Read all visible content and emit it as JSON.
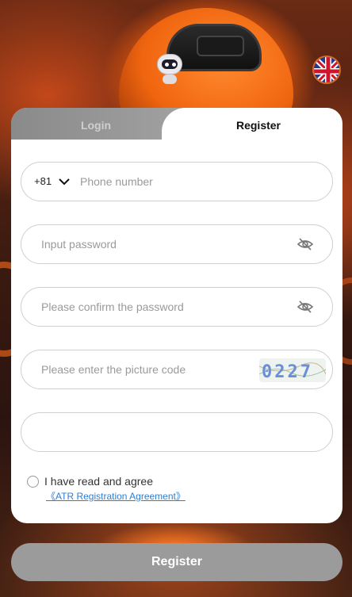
{
  "tabs": {
    "login_label": "Login",
    "register_label": "Register"
  },
  "form": {
    "country_code": "+81",
    "phone_placeholder": "Phone number",
    "password_placeholder": "Input password",
    "confirm_placeholder": "Please confirm the password",
    "captcha_placeholder": "Please enter the picture code",
    "captcha_code": "0227",
    "extra_field_value": ""
  },
  "agreement": {
    "text": "I have read and agree",
    "link": "《ATR Registration Agreement》"
  },
  "submit_label": "Register",
  "icons": {
    "avatar": "robot-avatar-icon",
    "language": "uk-flag-icon",
    "country_dropdown": "chevron-down-icon",
    "password_toggle": "eye-off-icon"
  },
  "colors": {
    "accent_orange": "#f0650f",
    "link_blue": "#2f7dd3",
    "button_gray": "#9b9b9b"
  }
}
